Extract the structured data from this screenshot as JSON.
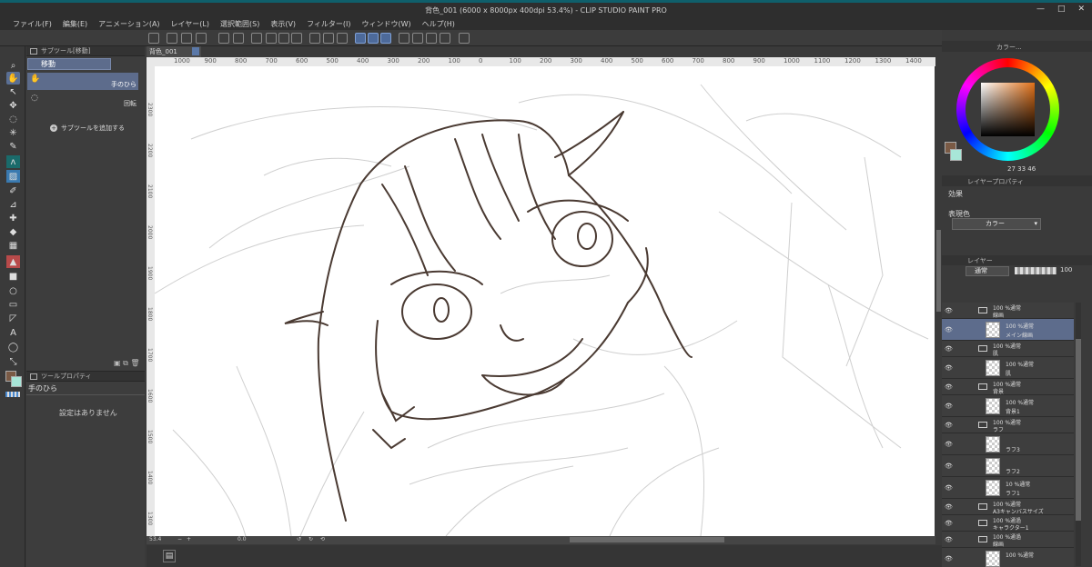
{
  "window": {
    "title": "背色_001 (6000 x 8000px 400dpi 53.4%) - CLIP STUDIO PAINT PRO",
    "controls": [
      "—",
      "□",
      "✕"
    ]
  },
  "menu": [
    "ファイル(F)",
    "編集(E)",
    "アニメーション(A)",
    "レイヤー(L)",
    "選択範囲(S)",
    "表示(V)",
    "フィルター(I)",
    "ウィンドウ(W)",
    "ヘルプ(H)"
  ],
  "subtool_panel": {
    "header": "サブツール[移動]",
    "tab_label": "移動",
    "items": [
      {
        "label": "手のひら",
        "selected": true
      },
      {
        "label": "回転",
        "selected": false
      }
    ],
    "add_label": "サブツールを追加する"
  },
  "tool_property": {
    "header": "ツールプロパティ",
    "tool_name": "手のひら",
    "empty_message": "設定はありません"
  },
  "document": {
    "tab": "背色_001",
    "ruler_top": [
      "1000",
      "900",
      "800",
      "700",
      "600",
      "500",
      "400",
      "300",
      "200",
      "100",
      "0",
      "100",
      "200",
      "300",
      "400",
      "500",
      "600",
      "700",
      "800",
      "900",
      "1000",
      "1100",
      "1200",
      "1300",
      "1400"
    ],
    "ruler_left": [
      "2300",
      "2200",
      "2100",
      "2000",
      "1900",
      "1800",
      "1700",
      "1600",
      "1500",
      "1400",
      "1300"
    ],
    "status_zoom": "53.4",
    "status_angle": "0.0"
  },
  "color_panel": {
    "header": "カラー...",
    "main_color": "#7a5a45",
    "sub_color": "#a8e6d8",
    "hsv": "27  33  46"
  },
  "layer_property": {
    "header": "レイヤープロパティ",
    "effect_label": "効果",
    "expression_label": "表現色",
    "expression_value": "カラー"
  },
  "layer_panel": {
    "header": "レイヤー",
    "blend_mode": "通常",
    "opacity": "100",
    "layers": [
      {
        "name": "線画",
        "mode": "100 %通常",
        "type": "folder"
      },
      {
        "name": "メイン線画",
        "mode": "100 %通常",
        "type": "raster",
        "selected": true
      },
      {
        "name": "肌",
        "mode": "100 %通常",
        "type": "folder"
      },
      {
        "name": "肌",
        "mode": "100 %通常",
        "type": "raster"
      },
      {
        "name": "背景",
        "mode": "100 %通常",
        "type": "folder"
      },
      {
        "name": "背景1",
        "mode": "100 %通常",
        "type": "raster"
      },
      {
        "name": "ラフ",
        "mode": "100 %通常",
        "type": "folder"
      },
      {
        "name": "ラフ3",
        "mode": "",
        "type": "raster"
      },
      {
        "name": "ラフ2",
        "mode": "",
        "type": "raster"
      },
      {
        "name": "ラフ1",
        "mode": "10 %通常",
        "type": "raster"
      },
      {
        "name": "A3キャンバスサイズ",
        "mode": "100 %通常",
        "type": "folder"
      },
      {
        "name": "キャラクター1",
        "mode": "100 %通過",
        "type": "folder"
      },
      {
        "name": "線画",
        "mode": "100 %通過",
        "type": "folder"
      },
      {
        "name": "",
        "mode": "100 %通常",
        "type": "raster"
      }
    ]
  }
}
